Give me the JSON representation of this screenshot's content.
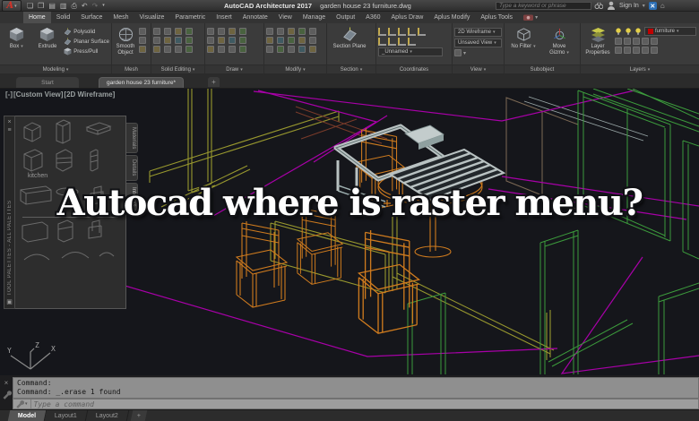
{
  "window": {
    "logo_letter": "A",
    "app_title": "AutoCAD Architecture 2017",
    "doc_title": "garden house 23 furniture.dwg",
    "search_placeholder": "Type a keyword or phrase",
    "sign_in_label": "Sign In"
  },
  "ribbon_tabs": {
    "active": "Home",
    "tabs": [
      "Home",
      "Solid",
      "Surface",
      "Mesh",
      "Visualize",
      "Parametric",
      "Insert",
      "Annotate",
      "View",
      "Manage",
      "Output",
      "A360",
      "Aplus Draw",
      "Aplus Modify",
      "Aplus Tools"
    ]
  },
  "ribbon": {
    "modeling": {
      "label": "Modeling",
      "box": "Box",
      "extrude": "Extrude",
      "polysolid": "Polysolid",
      "planar_surface": "Planar Surface",
      "press_pull": "Press/Pull"
    },
    "mesh": {
      "label": "Mesh",
      "smooth_object": "Smooth Object"
    },
    "solid_editing": {
      "label": "Solid Editing"
    },
    "draw": {
      "label": "Draw"
    },
    "modify": {
      "label": "Modify"
    },
    "section": {
      "label": "Section",
      "section_plane": "Section Plane"
    },
    "coordinates": {
      "label": "Coordinates",
      "view_name": "_Unnamed"
    },
    "view": {
      "label": "View",
      "visual_style": "2D Wireframe",
      "named_view": "Unsaved View"
    },
    "subobject": {
      "label": "Subobject",
      "no_filter": "No Filter",
      "move_gizmo": "Move Gizmo"
    },
    "layers": {
      "label": "Layers",
      "layer_properties": "Layer Properties",
      "current_layer": "furniture",
      "layer_color": "#c00000"
    }
  },
  "file_tabs": {
    "start": "Start",
    "drawing": "garden house 23 furniture*",
    "new_tab": "+"
  },
  "viewport": {
    "minimize": "[-]",
    "view_name": "[Custom View]",
    "visual_style": "[2D Wireframe]"
  },
  "tool_palette": {
    "title": "TOOL PALETTES - ALL PALETTES",
    "group_label": "kitchen",
    "side_tabs": [
      "Materials",
      "Details",
      "Interiors"
    ]
  },
  "overlay": {
    "text": "Autocad where is raster menu?"
  },
  "command_line": {
    "history": [
      "Command:",
      "Command: _.erase 1 found"
    ],
    "input_placeholder": "Type a command"
  },
  "layout_tabs": {
    "active": "Model",
    "tabs": [
      "Model",
      "Layout1",
      "Layout2"
    ],
    "new_tab": "+"
  },
  "ucs_axes": {
    "x": "X",
    "y": "Y",
    "z": "Z"
  },
  "canvas_colors": {
    "background": "#15161b",
    "wire_green": "#3c9b3c",
    "wire_magenta": "#a800a8",
    "wire_orange": "#cf7b1e",
    "wire_olive": "#98982e",
    "solid_light": "#b9c2c2"
  }
}
